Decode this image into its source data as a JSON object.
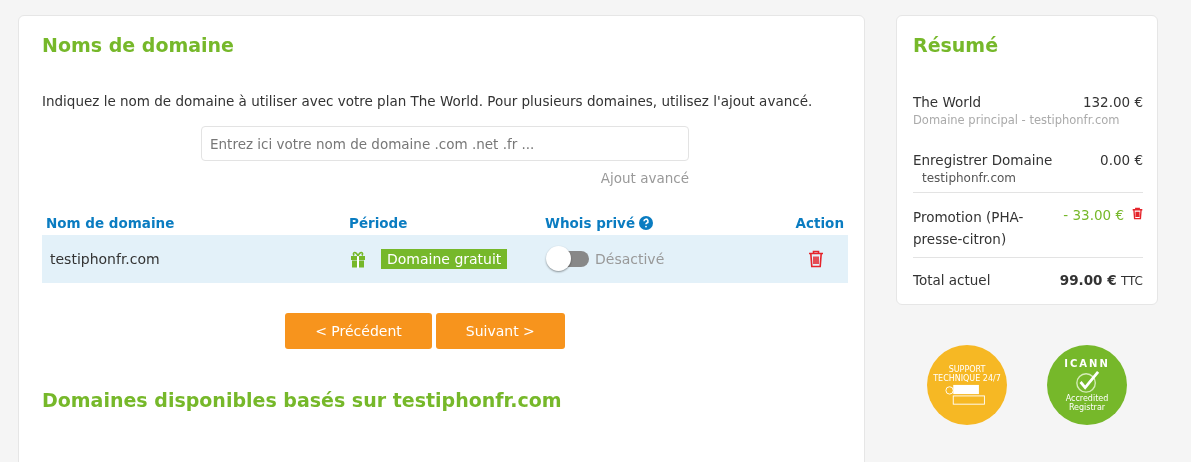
{
  "main": {
    "title": "Noms de domaine",
    "description": "Indiquez le nom de domaine à utiliser avec votre plan The World. Pour plusieurs domaines, utilisez l'ajout avancé.",
    "search": {
      "placeholder": "Entrez ici votre nom de domaine .com .net .fr ..."
    },
    "advanced_link": "Ajout avancé",
    "table": {
      "columns": [
        "Nom de domaine",
        "Période",
        "Whois privé",
        "Action"
      ],
      "rows": [
        {
          "domain": "testiphonfr.com",
          "period": "Domaine gratuit",
          "whois": {
            "on": false,
            "status": "Désactivé"
          }
        }
      ]
    },
    "buttons": [
      "< Précédent",
      "Suivant >"
    ],
    "section_title": "Domaines disponibles basés sur testiphonfr.com"
  },
  "summary": {
    "title": "Résumé",
    "items": [
      {
        "kind": "line",
        "label": "The World",
        "price": "132.00 €",
        "sub": "Domaine principal - testiphonfr.com"
      },
      {
        "kind": "line",
        "label": "Enregistrer Domaine",
        "price": "0.00 €",
        "sub": "testiphonfr.com"
      },
      {
        "kind": "promo",
        "label": "Promotion (PHA-presse-citron)",
        "price": "- 33.00 €"
      },
      {
        "kind": "total",
        "label": "Total actuel",
        "price": "99.00 €",
        "suffix": "TTC"
      }
    ]
  },
  "badges": [
    {
      "kind": "support",
      "lines": [
        "SUPPORT",
        "TECHNIQUE 24/7"
      ]
    },
    {
      "kind": "icann",
      "lines": [
        "ICANN",
        "Accredited Registrar"
      ]
    }
  ]
}
